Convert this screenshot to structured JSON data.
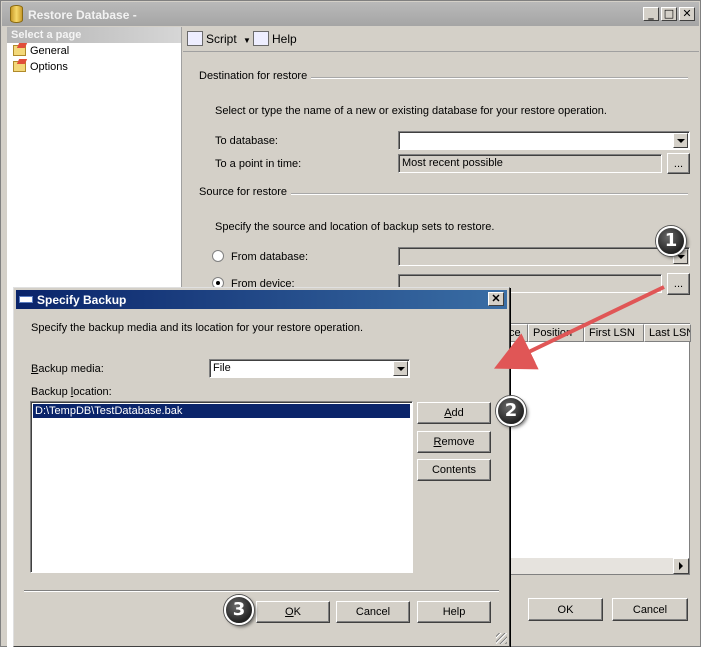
{
  "window": {
    "title": "Restore Database -",
    "minimize_glyph": "_",
    "maximize_glyph": "□",
    "close_glyph": "✕"
  },
  "sidebar": {
    "header": "Select a page",
    "items": [
      {
        "label": "General",
        "icon": "page-icon"
      },
      {
        "label": "Options",
        "icon": "page-icon"
      }
    ]
  },
  "toolbar": {
    "script_label": "Script",
    "help_label": "Help"
  },
  "destination": {
    "header": "Destination for restore",
    "instruction": "Select or type the name of a new or existing database for your restore operation.",
    "to_database_label": "To database:",
    "to_database_value": "",
    "point_in_time_label": "To a point in time:",
    "point_in_time_value": "Most recent possible",
    "browse_label": "..."
  },
  "source": {
    "header": "Source for restore",
    "instruction": "Specify the source and location of backup sets to restore.",
    "from_database_label": "From database:",
    "from_device_label": "From device:",
    "selected": "device",
    "browse_label": "..."
  },
  "grid": {
    "columns": [
      "ce",
      "Position",
      "First LSN",
      "Last LSN"
    ]
  },
  "main_buttons": {
    "ok": "OK",
    "cancel": "Cancel"
  },
  "dialog": {
    "title": "Specify Backup",
    "close_glyph": "✕",
    "instruction": "Specify the backup media and its location for your restore operation.",
    "media_label_pre": "",
    "media_label_accel": "B",
    "media_label_post": "ackup media:",
    "media_value": "File",
    "location_label_pre": "Backup ",
    "location_label_accel": "l",
    "location_label_post": "ocation:",
    "locations": [
      "D:\\TempDB\\TestDatabase.bak"
    ],
    "add_label_accel": "A",
    "add_label_post": "dd",
    "remove_label_accel": "R",
    "remove_label_post": "emove",
    "contents_label": "Contents",
    "ok_label_accel": "O",
    "ok_label_post": "K",
    "cancel_label": "Cancel",
    "help_label": "Help"
  },
  "annotations": {
    "step1": "1",
    "step2": "2",
    "step3": "3",
    "arrow_color": "#e05656"
  },
  "colors": {
    "dialog_title": "#0a246a",
    "selection": "#0a246a",
    "face": "#d4d0c8"
  }
}
